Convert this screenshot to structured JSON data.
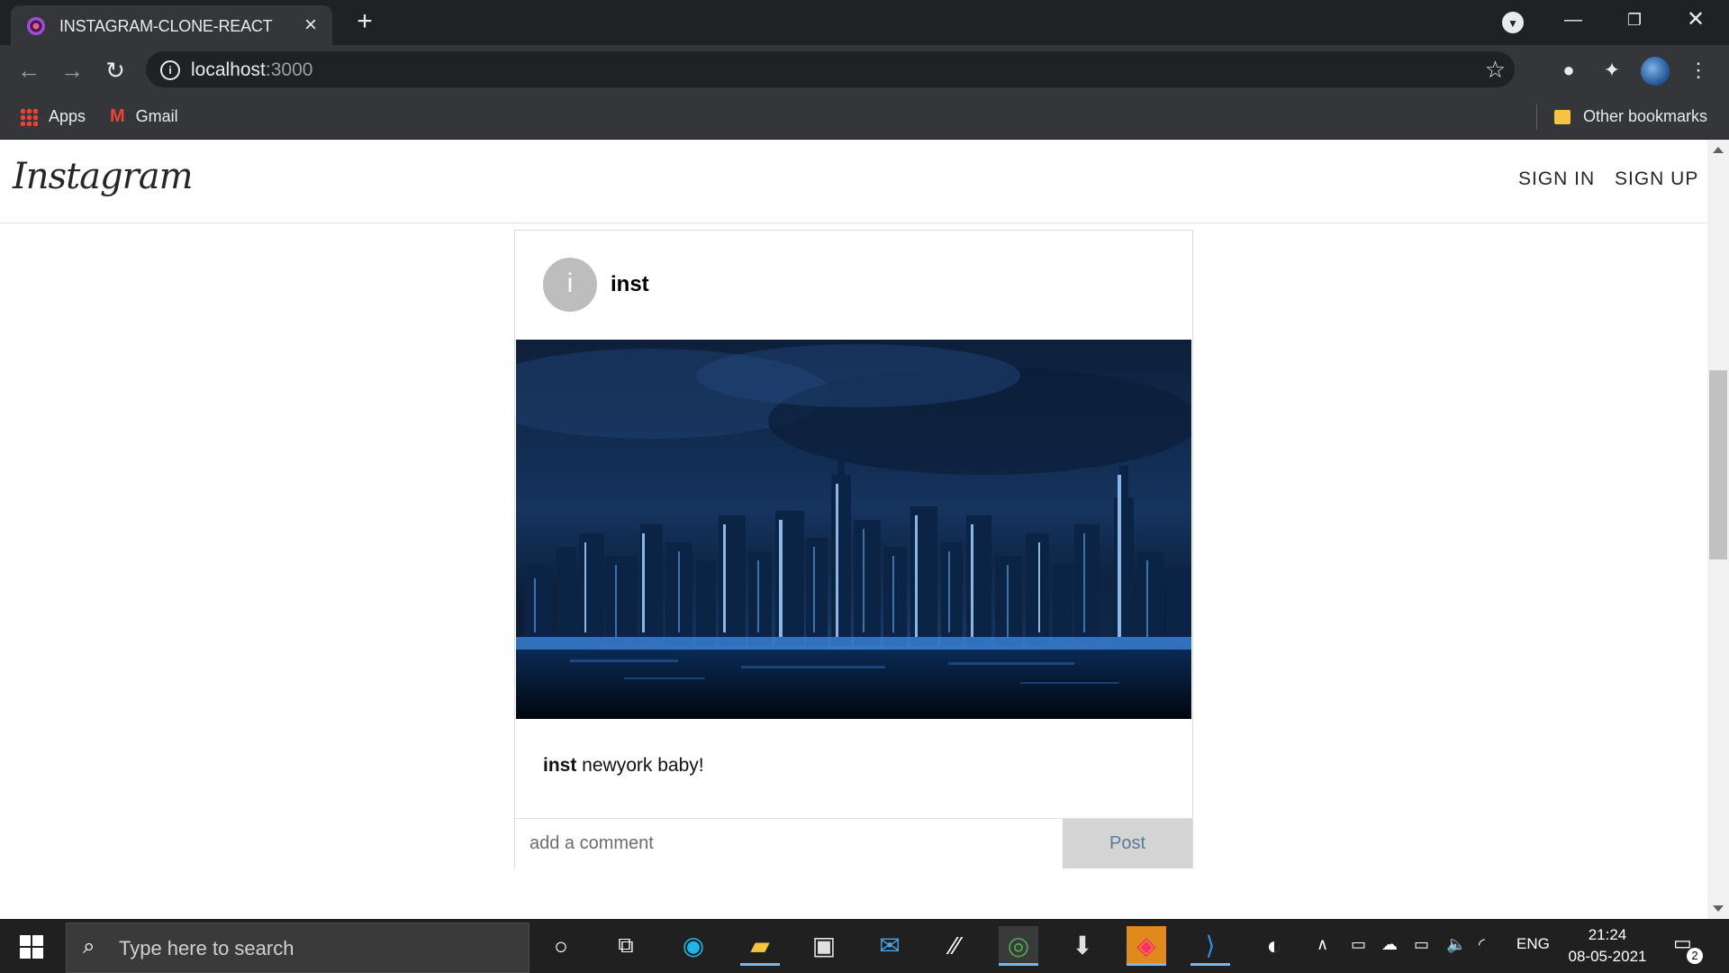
{
  "browser": {
    "tab_title": "INSTAGRAM-CLONE-REACT",
    "new_tab": "+",
    "url_host": "localhost",
    "url_port": ":3000",
    "bookmarks": [
      {
        "label": "Apps",
        "icon": "apps-grid-icon"
      },
      {
        "label": "Gmail",
        "icon": "gmail-icon"
      }
    ],
    "other_bookmarks": "Other bookmarks"
  },
  "header": {
    "logo": "Instagram",
    "sign_in": "SIGN IN",
    "sign_up": "SIGN UP"
  },
  "post": {
    "avatar_letter": "i",
    "username": "inst",
    "image_description": "New York City skyline at night, blue tones",
    "caption_user": "inst",
    "caption_text": " newyork baby!",
    "comment_placeholder": "add a comment",
    "post_button": "Post"
  },
  "taskbar": {
    "search_placeholder": "Type here to search",
    "language": "ENG",
    "time": "21:24",
    "date": "08-05-2021",
    "notification_count": "2"
  },
  "colors": {
    "chrome_dark": "#202124",
    "chrome_toolbar": "#35363a",
    "post_button_bg": "#d4d4d4",
    "taskbar": "#202020"
  }
}
